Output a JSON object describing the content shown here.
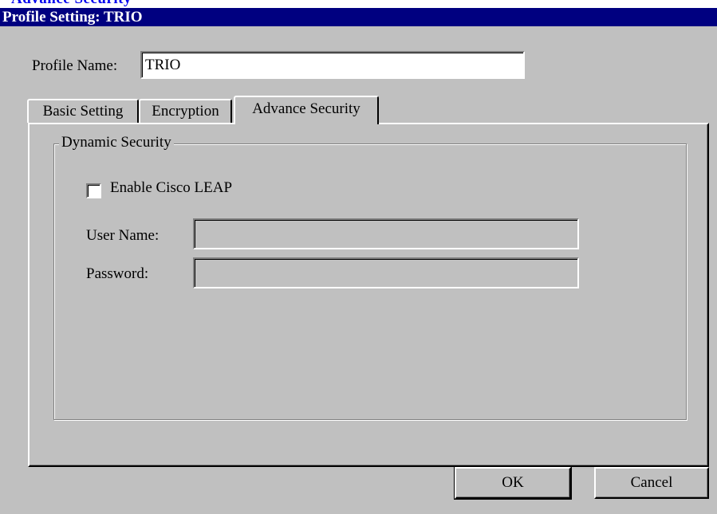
{
  "header_strip": {
    "text": "Advance Security"
  },
  "window": {
    "title": "Profile Setting: TRIO"
  },
  "profile": {
    "label": "Profile Name:",
    "value": "TRIO"
  },
  "tabs": [
    {
      "label": "Basic Setting",
      "active": false
    },
    {
      "label": "Encryption",
      "active": false
    },
    {
      "label": "Advance Security",
      "active": true
    }
  ],
  "dynamic_security": {
    "group_title": "Dynamic Security",
    "leap_label": "Enable Cisco LEAP",
    "leap_checked": false,
    "username_label": "User Name:",
    "username_value": "",
    "password_label": "Password:",
    "password_value": ""
  },
  "buttons": {
    "ok": "OK",
    "cancel": "Cancel"
  },
  "colors": {
    "titlebar": "#000080",
    "face": "#c0c0c0",
    "link": "#0000ee"
  }
}
